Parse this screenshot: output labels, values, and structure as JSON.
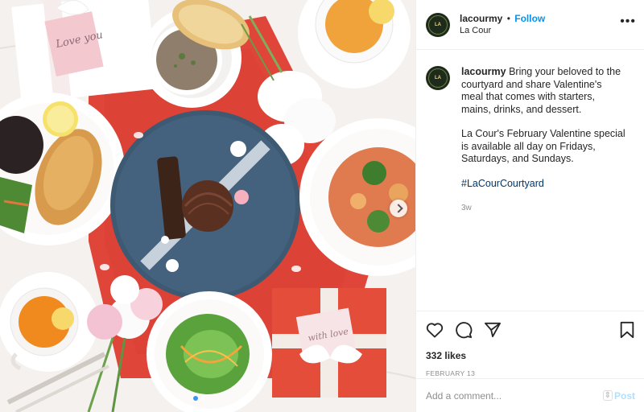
{
  "post": {
    "username": "lacourmy",
    "separator": "•",
    "follow_label": "Follow",
    "location": "La Cour",
    "more_icon": "more-horizontal-icon",
    "avatar_text": "LA"
  },
  "caption": {
    "username": "lacourmy",
    "paragraph1": "Bring your beloved to the courtyard and share Valentine's meal that comes with starters, mains, drinks, and dessert.",
    "paragraph2": "La Cour's February Valentine special is available all day on Fridays, Saturdays, and Sundays.",
    "hashtag": "#LaCourCourtyard",
    "time": "3w"
  },
  "actions": {
    "like_icon": "heart-icon",
    "comment_icon": "comment-icon",
    "share_icon": "paper-plane-icon",
    "save_icon": "bookmark-icon",
    "likes": "332 likes",
    "date": "FEBRUARY 13"
  },
  "comment": {
    "placeholder": "Add a comment...",
    "post_label": "Post"
  },
  "photo": {
    "card1_text": "Love you",
    "card2_text": "with love",
    "carousel_current": 1,
    "carousel_total": 2
  },
  "colors": {
    "accent": "#0095f6",
    "post_disabled": "#b2dffc",
    "tablecloth": "#e0453a",
    "blue_plate": "#3e5a73"
  }
}
